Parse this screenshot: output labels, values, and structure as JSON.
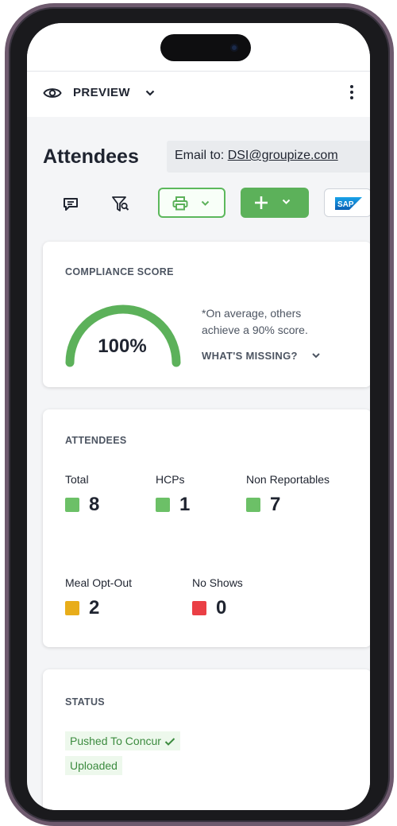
{
  "app": {
    "preview_label": "PREVIEW",
    "page_title": "Attendees",
    "email_label": "Email to: ",
    "email_address": "DSI@groupize.com",
    "sap_label": "SAP"
  },
  "colors": {
    "accent_green": "#5cb15a",
    "swatch_green": "#6cc067",
    "swatch_yellow": "#e8ad1a",
    "swatch_red": "#ea3f45"
  },
  "icons": [
    "eye-icon",
    "chevron-down-icon",
    "kebab-menu-icon",
    "comment-icon",
    "filter-search-icon",
    "printer-icon",
    "plus-icon",
    "sap-logo",
    "check-icon"
  ],
  "compliance": {
    "title": "COMPLIANCE SCORE",
    "score_label": "100%",
    "score_fraction": 1.0,
    "note_line1": "*On average, others",
    "note_line2": "achieve a 90% score.",
    "missing_label": "WHAT'S MISSING?"
  },
  "attendees": {
    "title": "ATTENDEES",
    "stats": [
      {
        "label": "Total",
        "value": "8",
        "color": "green"
      },
      {
        "label": "HCPs",
        "value": "1",
        "color": "green"
      },
      {
        "label": "Non Reportables",
        "value": "7",
        "color": "green"
      },
      {
        "label": "Meal Opt-Out",
        "value": "2",
        "color": "yellow"
      },
      {
        "label": "No Shows",
        "value": "0",
        "color": "red"
      }
    ]
  },
  "status": {
    "title": "STATUS",
    "items": [
      {
        "label": "Pushed To Concur",
        "checked": true
      },
      {
        "label": "Uploaded",
        "checked": false
      }
    ]
  }
}
